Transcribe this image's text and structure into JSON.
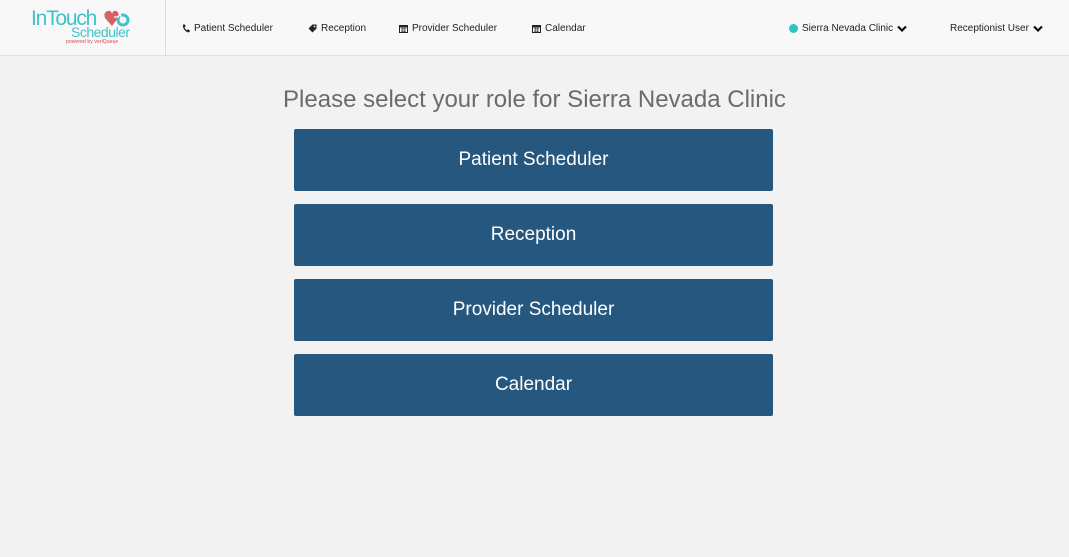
{
  "app": {
    "logo_main": "InTouch",
    "logo_sub": "Scheduler",
    "logo_powered": "powered by veriQueue"
  },
  "nav": {
    "links": [
      {
        "label": "Patient Scheduler",
        "icon": "phone-icon"
      },
      {
        "label": "Reception",
        "icon": "tag-icon"
      },
      {
        "label": "Provider Scheduler",
        "icon": "calendar-icon"
      },
      {
        "label": "Calendar",
        "icon": "calendar-icon"
      }
    ],
    "clinic": {
      "label": "Sierra Nevada Clinic",
      "status_color": "#2ec4c4"
    },
    "user": {
      "label": "Receptionist User"
    }
  },
  "main": {
    "title": "Please select your role for Sierra Nevada Clinic",
    "roles": [
      {
        "label": "Patient Scheduler"
      },
      {
        "label": "Reception"
      },
      {
        "label": "Provider Scheduler"
      },
      {
        "label": "Calendar"
      }
    ]
  },
  "colors": {
    "accent": "#25577f",
    "brand_teal": "#3fc3c9",
    "brand_red": "#d0474a",
    "background": "#f2f2f2"
  }
}
